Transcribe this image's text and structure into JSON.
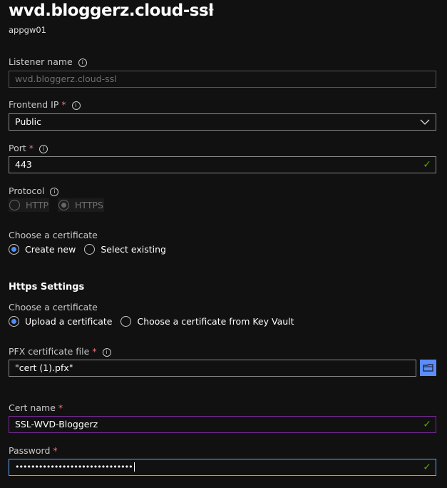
{
  "header": {
    "title": "wvd.bloggerz.cloud-ssl",
    "subtitle": "appgw01",
    "more_label": "···"
  },
  "listener_name": {
    "label": "Listener name",
    "value": "wvd.bloggerz.cloud-ssl"
  },
  "frontend_ip": {
    "label": "Frontend IP",
    "required": "*",
    "value": "Public"
  },
  "port": {
    "label": "Port",
    "required": "*",
    "value": "443"
  },
  "protocol": {
    "label": "Protocol",
    "options": [
      "HTTP",
      "HTTPS"
    ],
    "selected": "HTTPS"
  },
  "certificate_choice": {
    "label": "Choose a certificate",
    "options": [
      "Create new",
      "Select existing"
    ],
    "selected": "Create new"
  },
  "https_settings": {
    "heading": "Https Settings",
    "choose_label": "Choose a certificate",
    "options": [
      "Upload a certificate",
      "Choose a certificate from Key Vault"
    ],
    "selected": "Upload a certificate"
  },
  "pfx_file": {
    "label": "PFX certificate file",
    "required": "*",
    "value": "\"cert (1).pfx\""
  },
  "cert_name": {
    "label": "Cert name",
    "required": "*",
    "value": "SSL-WVD-Bloggerz"
  },
  "password": {
    "label": "Password",
    "required": "*",
    "value": "••••••••••••••••••••••••••••••"
  },
  "icons": {
    "info": "i",
    "check": "✓",
    "chevron": "chevron-down",
    "folder": "folder-icon"
  },
  "colors": {
    "accent": "#4f8cff",
    "valid": "#57a300",
    "required": "#f1707b",
    "focus_border": "#6aa8ff",
    "hover_border": "#8a2be2"
  }
}
